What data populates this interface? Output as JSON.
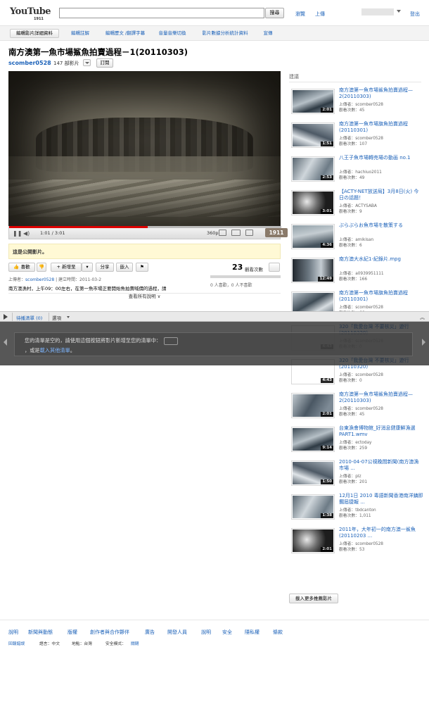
{
  "masthead": {
    "logo_text": "YouTube",
    "logo_year": "1911",
    "search_button": "搜尋",
    "browse_link": "瀏覽",
    "upload_link": "上傳",
    "logout_link": "登出"
  },
  "owner_toolbar": {
    "items": [
      "編輯影片詳細資料",
      "編輯註解",
      "編輯歷文 /翻譯字幕",
      "音量音樂切換",
      "影片數據分析統計資料",
      "宣傳"
    ]
  },
  "video": {
    "title": "南方澳第一魚市場鯊魚拍賣過程－1(20110303)",
    "channel": "scomber0528",
    "channel_video_count": "147 部影片",
    "subscribe_label": "訂閱",
    "time_display": "1:01 / 3:01",
    "quality": "360p",
    "year_badge": "1911",
    "progress_fraction": 0.51
  },
  "public_notice": "這是公開影片。",
  "actions": {
    "like": "喜歡",
    "add_to": "新增至",
    "share": "分享",
    "embed": "嵌入"
  },
  "views": {
    "count": "23",
    "label": "觀看次數",
    "likes_text": "0 人喜歡，0 人不喜歡"
  },
  "upload_info": {
    "prefix": "上傳者：",
    "user": "scomber0528",
    "suffix": "| 建立時間：2011-03-2"
  },
  "description": "南方澳漁村，上午09：00左右，在第一魚市場正要開始魚拍賣喊價的過程，請",
  "show_more": "查看所有說明 ∨",
  "sidebar": {
    "heading": "建議",
    "more_button": "載入更多推薦影片",
    "items": [
      {
        "title": "南方澳第一魚市場鯊魚拍賣過程—2(20110303)",
        "uploader": "上傳者：scomber0528",
        "views": "觀看次數：45",
        "duration": "2:01"
      },
      {
        "title": "南方澳第一魚市場旗魚拍賣過程(20110301)",
        "uploader": "上傳者：scomber0528",
        "views": "觀看次數：107",
        "duration": "1:51"
      },
      {
        "title": "八王子魚市場轉売場の動画 no.1",
        "uploader": "上傳者：hachiuo2011",
        "views": "觀看次數：49",
        "duration": "2:53"
      },
      {
        "title": "【ACTY-NET放送局】3月8日(火) 今日の話題！",
        "uploader": "上傳者：ACTYSABA",
        "views": "觀看次數：9",
        "duration": "3:01"
      },
      {
        "title": "ぶらぶらお魚市場を散策する",
        "uploader": "上傳者：amikisan",
        "views": "觀看次數：6",
        "duration": "4:36"
      },
      {
        "title": "南方澳大水紀1-紀錄片.mpg",
        "uploader": "上傳者：a0939951111",
        "views": "觀看次數：166",
        "duration": "12:49"
      },
      {
        "title": "南方澳第一魚市場旗魚拍賣過程(20110301)",
        "uploader": "上傳者：scomber0528",
        "views": "觀看次數：66",
        "duration": ""
      },
      {
        "title": "320「我愛台灣 不要核災」遊行(20110320)",
        "uploader": "上傳者：scomber0528",
        "views": "觀看次數：0",
        "duration": "4:43"
      },
      {
        "title": "320「我愛台灣 不要核災」遊行(20110320)",
        "uploader": "上傳者：scomber0528",
        "views": "觀看次數：0",
        "duration": "4:43"
      },
      {
        "title": "南方澳第一魚市場鯊魚拍賣過程—2(20110303)",
        "uploader": "上傳者：scomber0528",
        "views": "觀看次數：45",
        "duration": "2:01"
      },
      {
        "title": "台東漁會博物館_好消息健康鮮漁選PART1.wmv",
        "uploader": "上傳者：ectoday",
        "views": "觀看次數：259",
        "duration": "9:14"
      },
      {
        "title": "2010-04-07公視晚間新聞(南方澳漁市場 ...",
        "uploader": "上傳者：plz",
        "views": "觀看次數：201",
        "duration": "1:50"
      },
      {
        "title": "12月1日 2010 毒語新聞香港南洋鎮即擱屆捷報 ...",
        "uploader": "上傳者：tbdcanton",
        "views": "觀看次數：1,011",
        "duration": "1:38"
      },
      {
        "title": "2011年，大年初一的南方澳一鯊魚(20110203 ...",
        "uploader": "上傳者：scomber0528",
        "views": "觀看次數：53",
        "duration": "2:01"
      }
    ]
  },
  "playlist": {
    "label": "待播清單 (0)",
    "options": "選項",
    "message_line1": "您的清單是空的，請使用這個按鈕將影片新增至您的清單中：",
    "message_line2_prefix": "，或是",
    "message_line2_link": "載入其他清單",
    "message_line2_suffix": "。"
  },
  "footer": {
    "links": [
      "說明",
      "新聞與動態",
      "版權",
      "創作者與合作夥伴",
      "廣告",
      "開發人員",
      "說明",
      "安全",
      "隱私權",
      "條款"
    ],
    "small": {
      "brand": "回報錯誤",
      "language": "語言：中文",
      "location": "地點：台灣",
      "safety_prefix": "安全模式：",
      "safety_value": "關閉"
    }
  }
}
